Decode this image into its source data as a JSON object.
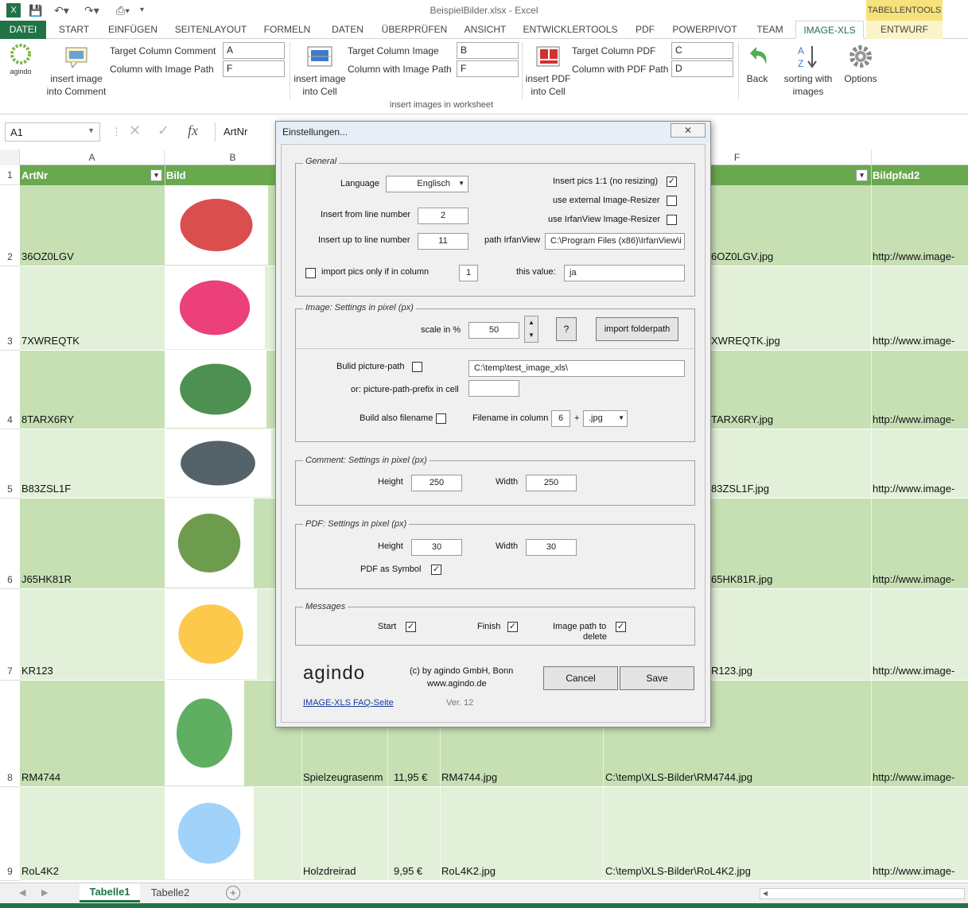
{
  "window": {
    "title": "BeispielBilder.xlsx - Excel",
    "tabletools_label": "TABELLENTOOLS"
  },
  "tabs": [
    "DATEI",
    "START",
    "EINFÜGEN",
    "SEITENLAYOUT",
    "FORMELN",
    "DATEN",
    "ÜBERPRÜFEN",
    "ANSICHT",
    "ENTWICKLERTOOLS",
    "PDF",
    "POWERPIVOT",
    "TEAM",
    "IMAGE-XLS",
    "ENTWURF"
  ],
  "ribbon": {
    "agindo_label": "agindo",
    "comment_btn": [
      "insert image",
      "into Comment"
    ],
    "comment_target_label": "Target Column Comment",
    "comment_target_value": "A",
    "comment_path_label": "Column with Image Path",
    "comment_path_value": "F",
    "cell_btn": [
      "insert image",
      "into Cell"
    ],
    "cell_target_label": "Target Column Image",
    "cell_target_value": "B",
    "cell_path_label": "Column with Image Path",
    "cell_path_value": "F",
    "pdf_btn": [
      "insert PDF",
      "into Cell"
    ],
    "pdf_target_label": "Target Column PDF",
    "pdf_target_value": "C",
    "pdf_path_label": "Column with PDF Path",
    "pdf_path_value": "D",
    "back_label": "Back",
    "sort_btn": [
      "sorting with",
      "images"
    ],
    "options_label": "Options",
    "group_label": "insert images in worksheet"
  },
  "formula": {
    "namebox": "A1",
    "fx": "fx",
    "content": "ArtNr"
  },
  "columns": [
    "A",
    "B",
    "F"
  ],
  "header_row": {
    "a": "ArtNr",
    "b": "Bild",
    "g": "Bildpfad2"
  },
  "rows": [
    {
      "num": "2",
      "a": "36OZ0LGV",
      "c": "",
      "e": "",
      "f": "",
      "g": "6OZ0LGV.jpg",
      "h": "http://www.image-"
    },
    {
      "num": "3",
      "a": "7XWREQTK",
      "c": "",
      "e": "",
      "f": "",
      "g": "XWREQTK.jpg",
      "h": "http://www.image-"
    },
    {
      "num": "4",
      "a": "8TARX6RY",
      "c": "",
      "e": "",
      "f": "",
      "g": "TARX6RY.jpg",
      "h": "http://www.image-"
    },
    {
      "num": "5",
      "a": "B83ZSL1F",
      "c": "",
      "e": "",
      "f": "",
      "g": "83ZSL1F.jpg",
      "h": "http://www.image-"
    },
    {
      "num": "6",
      "a": "J65HK81R",
      "c": "",
      "e": "",
      "f": "",
      "g": "65HK81R.jpg",
      "h": "http://www.image-"
    },
    {
      "num": "7",
      "a": "KR123",
      "c": "",
      "e": "",
      "f": "",
      "g": "R123.jpg",
      "h": "http://www.image-"
    },
    {
      "num": "8",
      "a": "RM4744",
      "c": "Spielzeugrasenm",
      "d": "11,95 €",
      "e": "RM4744.jpg",
      "f": "C:\\temp\\XLS-Bilder\\RM4744.jpg",
      "h": "http://www.image-"
    },
    {
      "num": "9",
      "a": "RoL4K2",
      "c": "Holzdreirad",
      "d": "9,95 €",
      "e": "RoL4K2.jpg",
      "f": "C:\\temp\\XLS-Bilder\\RoL4K2.jpg",
      "h": "http://www.image-"
    }
  ],
  "sheets": [
    "Tabelle1",
    "Tabelle2"
  ],
  "dialog": {
    "title": "Einstellungen...",
    "general": {
      "legend": "General",
      "language_label": "Language",
      "language_value": "Englisch",
      "from_label": "Insert from line number",
      "from_value": "2",
      "to_label": "Insert up to line number",
      "to_value": "11",
      "onlyif_label": "import pics only if in column",
      "onlyif_col": "1",
      "thisvalue_label": "this value:",
      "thisvalue_value": "ja",
      "pics11_label": "Insert pics 1:1 (no resizing)",
      "ext_resizer_label": "use external Image-Resizer",
      "irfan_resizer_label": "use IrfanView Image-Resizer",
      "irfan_path_label": "path IrfanView",
      "irfan_path_value": "C:\\Program Files (x86)\\IrfanView\\i"
    },
    "image": {
      "legend": "Image: Settings in pixel (px)",
      "scale_label": "scale in %",
      "scale_value": "50",
      "help_label": "?",
      "import_folder_label": "import folderpath",
      "build_path_label": "Bulid picture-path",
      "build_path_value": "C:\\temp\\test_image_xls\\",
      "prefix_label": "or: picture-path-prefix in cell",
      "build_filename_label": "Build also filename",
      "filename_col_label": "Filename in column",
      "filename_col_value": "6",
      "plus": "+",
      "ext_value": ".jpg"
    },
    "comment": {
      "legend": "Comment: Settings in pixel (px)",
      "height_label": "Height",
      "height_value": "250",
      "width_label": "Width",
      "width_value": "250"
    },
    "pdf": {
      "legend": "PDF: Settings in pixel (px)",
      "height_label": "Height",
      "height_value": "30",
      "width_label": "Width",
      "width_value": "30",
      "symbol_label": "PDF as Symbol"
    },
    "messages": {
      "legend": "Messages",
      "start_label": "Start",
      "finish_label": "Finish",
      "delete_label_1": "Image path to",
      "delete_label_2": "delete"
    },
    "footer": {
      "logo": "agindo",
      "copyright": "(c) by agindo GmbH, Bonn",
      "website": "www.agindo.de",
      "faq_link": "IMAGE-XLS FAQ-Seite",
      "version": "Ver. 12",
      "cancel": "Cancel",
      "save": "Save"
    }
  }
}
